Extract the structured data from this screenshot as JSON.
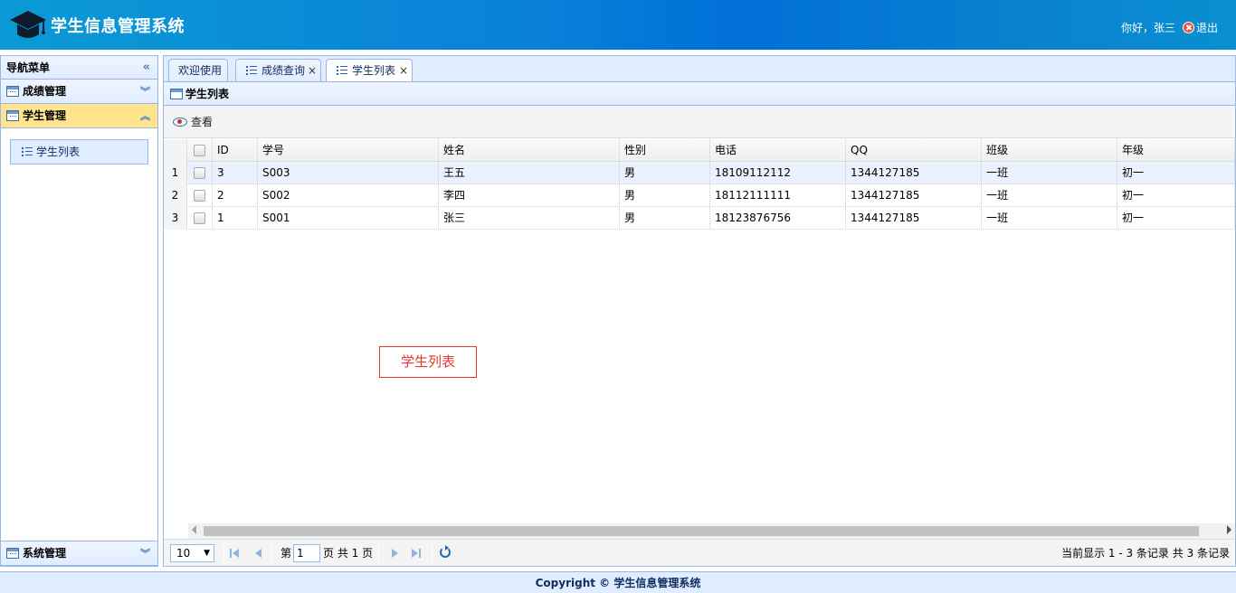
{
  "header": {
    "title": "学生信息管理系统",
    "greeting": "你好，张三",
    "logout_label": "退出",
    "logo_icon": "graduation-cap-icon"
  },
  "sidebar": {
    "title": "导航菜单",
    "sections": [
      {
        "label": "成绩管理",
        "expanded": false
      },
      {
        "label": "学生管理",
        "expanded": true,
        "items": [
          {
            "label": "学生列表"
          }
        ]
      },
      {
        "label": "系统管理",
        "expanded": false
      }
    ]
  },
  "tabs": [
    {
      "label": "欢迎使用",
      "closable": false
    },
    {
      "label": "成绩查询",
      "closable": true
    },
    {
      "label": "学生列表",
      "closable": true,
      "active": true
    }
  ],
  "tab_close": "×",
  "panel": {
    "title": "学生列表",
    "toolbar": {
      "view_label": "查看"
    },
    "annotation": "学生列表"
  },
  "grid": {
    "columns": [
      "ID",
      "学号",
      "姓名",
      "性别",
      "电话",
      "QQ",
      "班级",
      "年级"
    ],
    "rows": [
      {
        "num": "1",
        "cells": [
          "3",
          "S003",
          "王五",
          "男",
          "18109112112",
          "1344127185",
          "一班",
          "初一"
        ]
      },
      {
        "num": "2",
        "cells": [
          "2",
          "S002",
          "李四",
          "男",
          "18112111111",
          "1344127185",
          "一班",
          "初一"
        ]
      },
      {
        "num": "3",
        "cells": [
          "1",
          "S001",
          "张三",
          "男",
          "18123876756",
          "1344127185",
          "一班",
          "初一"
        ]
      }
    ]
  },
  "pager": {
    "page_size": "10",
    "page_prefix": "第",
    "page_value": "1",
    "page_suffix": "页 共 1 页",
    "info": "当前显示 1 - 3 条记录 共 3 条记录"
  },
  "footer": {
    "text": "Copyright © 学生信息管理系统"
  },
  "colors": {
    "accent": "#0a7fd8",
    "border": "#95b8e7",
    "panel_bg": "#e0ecff",
    "active_section": "#ffe48d"
  }
}
